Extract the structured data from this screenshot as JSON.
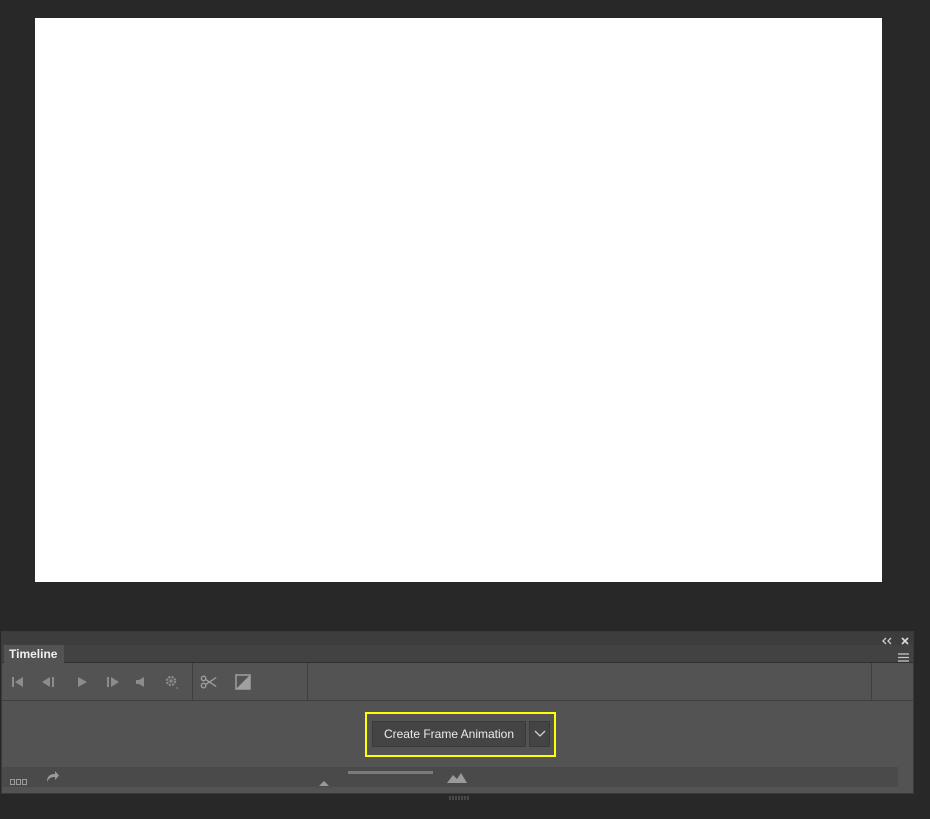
{
  "panel": {
    "tab_label": "Timeline"
  },
  "controls": {
    "icons": [
      "first-frame-icon",
      "previous-frame-icon",
      "play-icon",
      "next-frame-icon",
      "audio-icon",
      "settings-icon",
      "split-icon",
      "transition-icon"
    ]
  },
  "create": {
    "button_label": "Create Frame Animation"
  },
  "colors": {
    "highlight": "#ffff00",
    "panel_bg": "#535353",
    "workspace_bg": "#282828"
  }
}
